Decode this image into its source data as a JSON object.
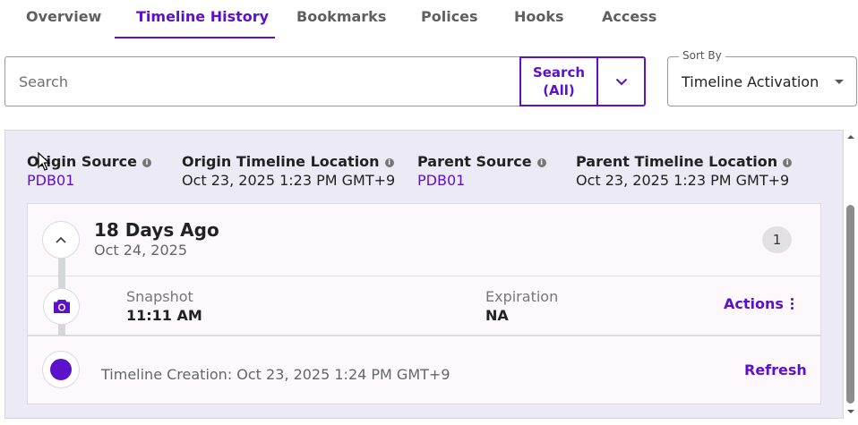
{
  "tabs": [
    {
      "label": "Overview",
      "active": false
    },
    {
      "label": "Timeline History",
      "active": true
    },
    {
      "label": "Bookmarks",
      "active": false
    },
    {
      "label": "Polices",
      "active": false
    },
    {
      "label": "Hooks",
      "active": false
    },
    {
      "label": "Access",
      "active": false
    }
  ],
  "search": {
    "placeholder": "Search",
    "value": "",
    "button_line1": "Search",
    "button_line2": "(All)",
    "dropdown_icon": "chevron-down-icon"
  },
  "sort": {
    "label": "Sort By",
    "value": "Timeline Activation"
  },
  "meta": {
    "origin_source_label": "Origin Source",
    "origin_source_value": "PDB01",
    "origin_location_label": "Origin Timeline Location",
    "origin_location_value": "Oct 23, 2025 1:23 PM GMT+9",
    "parent_source_label": "Parent Source",
    "parent_source_value": "PDB01",
    "parent_location_label": "Parent Timeline Location",
    "parent_location_value": "Oct 23, 2025 1:23 PM GMT+9",
    "info_icon": "i"
  },
  "group": {
    "title": "18 Days Ago",
    "date": "Oct 24, 2025",
    "count": "1",
    "collapse_icon": "chevron-up-icon"
  },
  "snapshot": {
    "type_label": "Snapshot",
    "time": "11:11 AM",
    "expiration_label": "Expiration",
    "expiration_value": "NA",
    "actions_label": "Actions",
    "icon": "camera-icon"
  },
  "creation": {
    "text": "Timeline Creation: Oct 23, 2025 1:24 PM GMT+9",
    "refresh_label": "Refresh"
  },
  "colors": {
    "accent": "#5b12c9",
    "panel_bg": "#eceaf4",
    "card_bg": "#fcf8fc"
  }
}
